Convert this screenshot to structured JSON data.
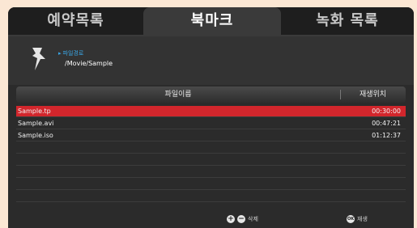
{
  "tabs": [
    {
      "label": "예약목록"
    },
    {
      "label": "북마크"
    },
    {
      "label": "녹화 목록"
    }
  ],
  "path": {
    "label": "파일경로",
    "value": "/Movie/Sample"
  },
  "table": {
    "header_name": "파일이름",
    "header_position": "재생위치",
    "rows": [
      {
        "name": "Sample.tp",
        "time": "00:30:00",
        "selected": true
      },
      {
        "name": "Sample.avi",
        "time": "00:47:21",
        "selected": false
      },
      {
        "name": "Sample.iso",
        "time": "01:12:37",
        "selected": false
      }
    ]
  },
  "footer": {
    "delete_label": "삭제",
    "play_label": "재생"
  },
  "colors": {
    "selection": "#d2262c",
    "path_label": "#3aa8e8"
  },
  "icons": {
    "pin": "pin-icon",
    "delete": "plus-minus-icon",
    "play": "ok-button-icon"
  }
}
